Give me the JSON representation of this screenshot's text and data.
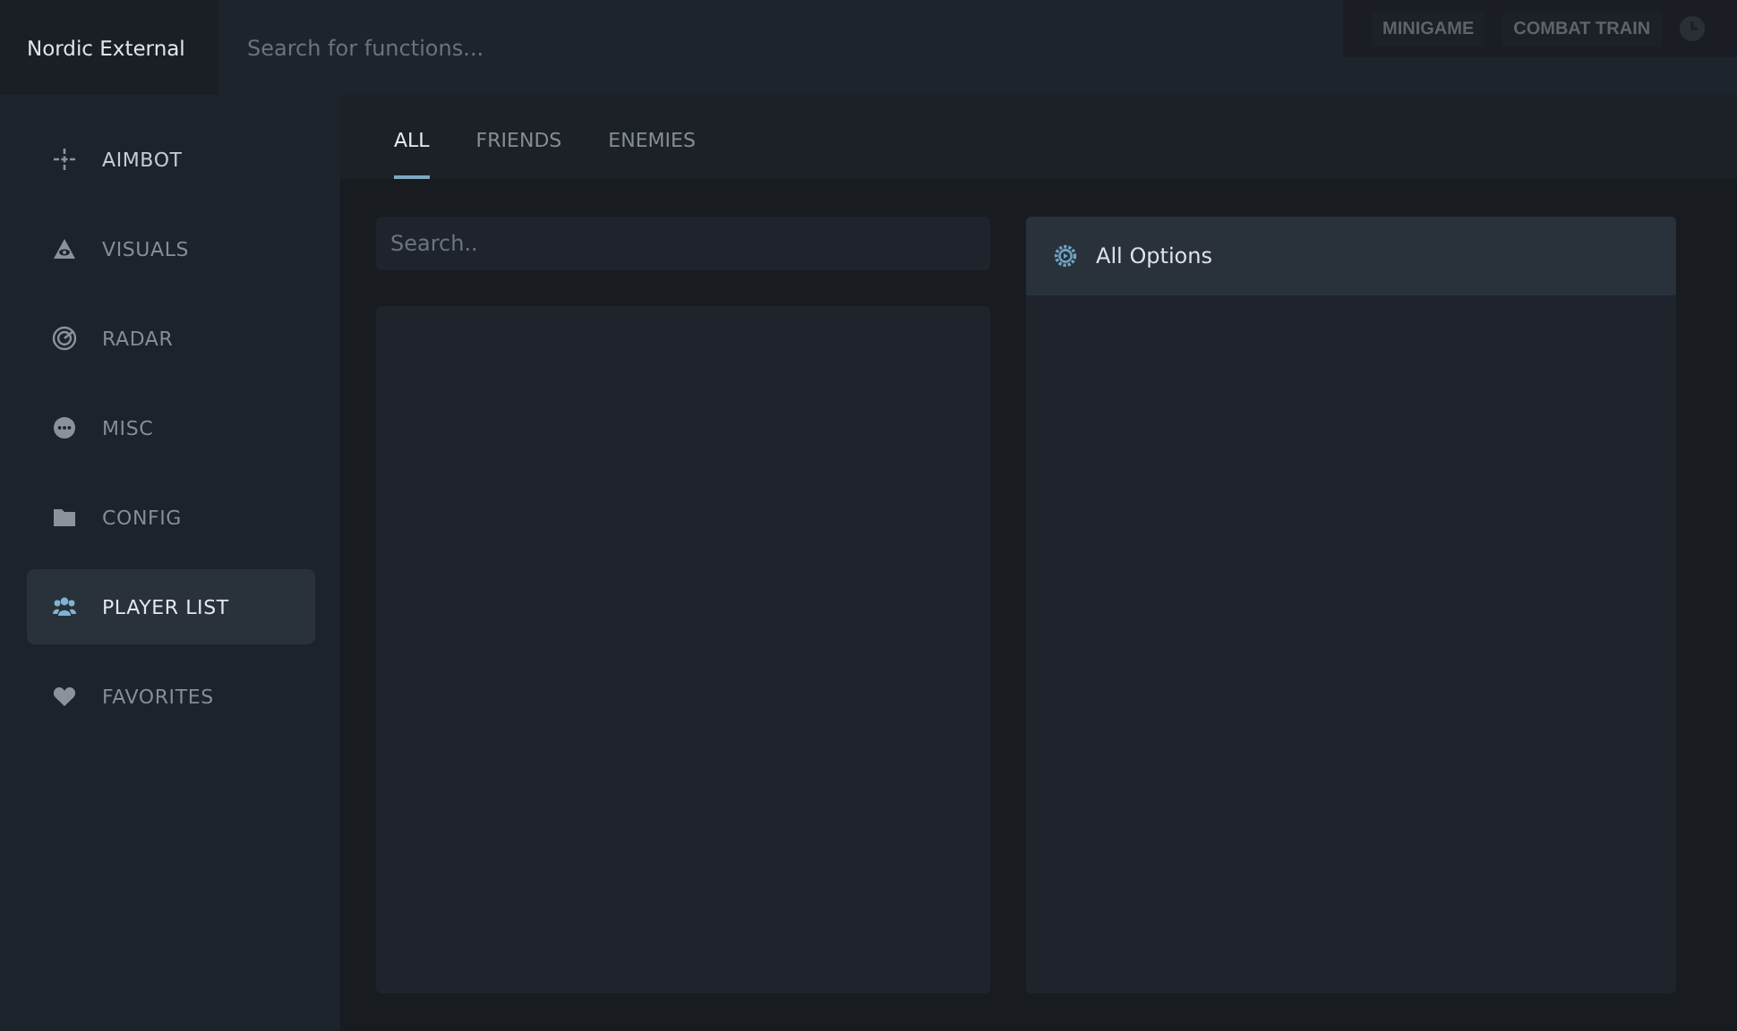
{
  "app": {
    "title": "Nordic External"
  },
  "search": {
    "placeholder": "Search for functions..."
  },
  "top_buttons": [
    {
      "label": "MINIGAME"
    },
    {
      "label": "COMBAT TRAIN"
    }
  ],
  "sidebar": {
    "items": [
      {
        "label": "AIMBOT",
        "selected": false
      },
      {
        "label": "VISUALS",
        "selected": false
      },
      {
        "label": "RADAR",
        "selected": false
      },
      {
        "label": "MISC",
        "selected": false
      },
      {
        "label": "CONFIG",
        "selected": false
      },
      {
        "label": "PLAYER LIST",
        "selected": true
      },
      {
        "label": "FAVORITES",
        "selected": false
      }
    ]
  },
  "tabs": [
    {
      "label": "ALL",
      "selected": true
    },
    {
      "label": "FRIENDS",
      "selected": false
    },
    {
      "label": "ENEMIES",
      "selected": false
    }
  ],
  "player_search": {
    "placeholder": "Search.."
  },
  "options_panel": {
    "title": "All Options"
  }
}
